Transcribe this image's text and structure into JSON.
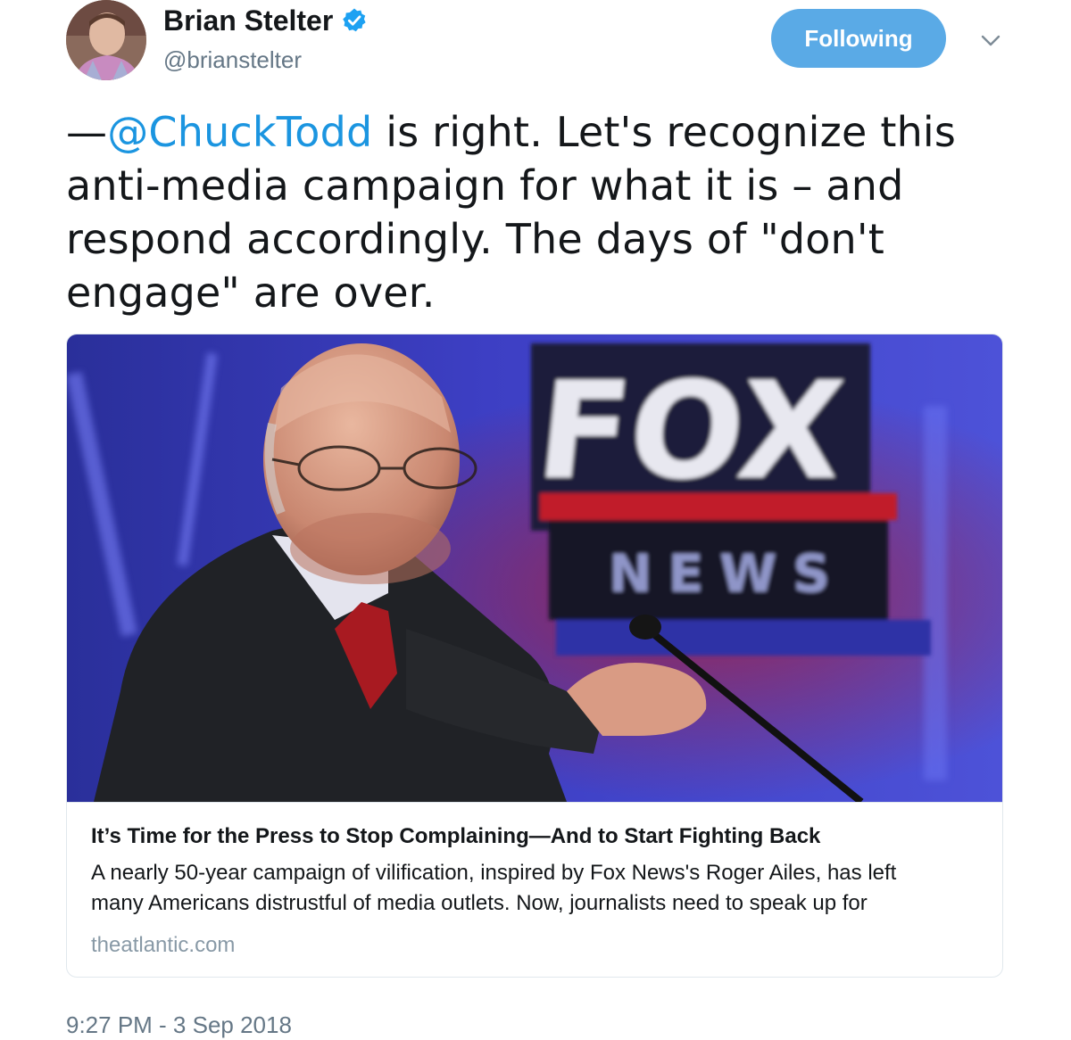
{
  "author": {
    "display_name": "Brian Stelter",
    "handle": "@brianstelter",
    "verified": true
  },
  "follow_button": {
    "label": "Following",
    "color": "#5aaae6"
  },
  "menu": {
    "icon": "chevron-down-icon"
  },
  "tweet": {
    "lines": [
      {
        "prefix": "—",
        "mention": "@ChuckTodd",
        "text": " is right. Let's recognize this"
      },
      {
        "text": "anti-media campaign for what it is – and"
      },
      {
        "text": "respond accordingly. The days of \"don't"
      },
      {
        "text": "engage\" are over."
      }
    ],
    "mention_color": "#1b95e0"
  },
  "card": {
    "image_text": {
      "logo_main": "FOX",
      "logo_sub": "NEWS"
    },
    "title": "It’s Time for the Press to Stop Complaining—And to Start Fighting Back",
    "description_lines": [
      "A nearly 50-year campaign of vilification, inspired by Fox News's Roger Ailes, has left",
      "many Americans distrustful of media outlets. Now, journalists need to speak up for"
    ],
    "domain": "theatlantic.com"
  },
  "timestamp": "9:27 PM - 3 Sep 2018"
}
